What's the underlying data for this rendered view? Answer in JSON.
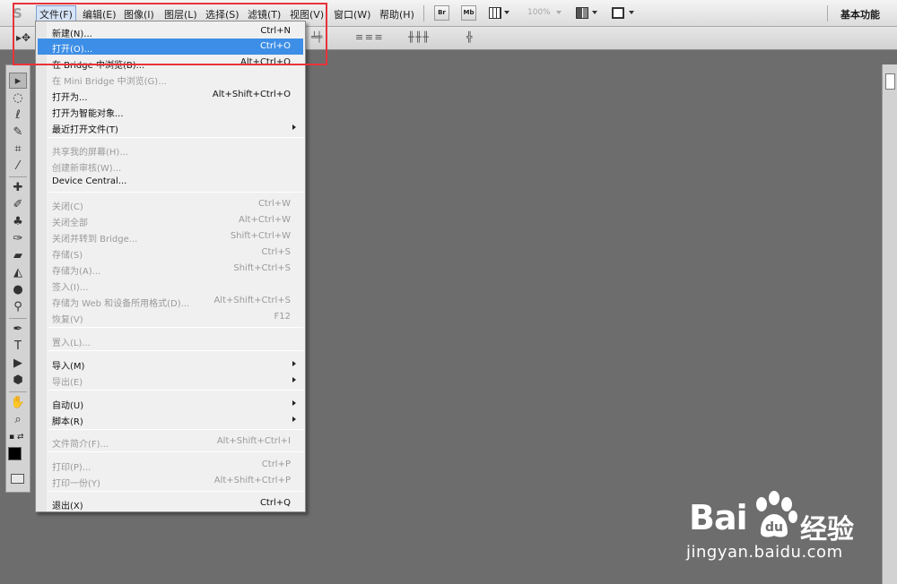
{
  "app": {
    "logo": "S",
    "menus": [
      {
        "label": "文件(F)",
        "open": true
      },
      {
        "label": "编辑(E)"
      },
      {
        "label": "图像(I)"
      },
      {
        "label": "图层(L)"
      },
      {
        "label": "选择(S)"
      },
      {
        "label": "滤镜(T)"
      },
      {
        "label": "视图(V)"
      },
      {
        "label": "窗口(W)"
      },
      {
        "label": "帮助(H)"
      }
    ],
    "bridge_button": "Br",
    "minibridge_button": "Mb",
    "zoom_level": "100%",
    "workspace": "基本功能"
  },
  "file_menu": {
    "items": [
      {
        "label": "新建(N)...",
        "shortcut": "Ctrl+N"
      },
      {
        "label": "打开(O)...",
        "shortcut": "Ctrl+O",
        "highlighted": true
      },
      {
        "label": "在 Bridge 中浏览(B)...",
        "shortcut": "Alt+Ctrl+O"
      },
      {
        "label": "在 Mini Bridge 中浏览(G)...",
        "shortcut": "",
        "disabled": true
      },
      {
        "label": "打开为...",
        "shortcut": "Alt+Shift+Ctrl+O"
      },
      {
        "label": "打开为智能对象...",
        "shortcut": ""
      },
      {
        "label": "最近打开文件(T)",
        "shortcut": "",
        "submenu": true
      },
      {
        "label": "共享我的屏幕(H)...",
        "shortcut": "",
        "disabled": true
      },
      {
        "label": "创建新审核(W)...",
        "shortcut": "",
        "disabled": true
      },
      {
        "label": "Device Central...",
        "shortcut": ""
      },
      {
        "label": "关闭(C)",
        "shortcut": "Ctrl+W",
        "disabled": true
      },
      {
        "label": "关闭全部",
        "shortcut": "Alt+Ctrl+W",
        "disabled": true
      },
      {
        "label": "关闭并转到 Bridge...",
        "shortcut": "Shift+Ctrl+W",
        "disabled": true
      },
      {
        "label": "存储(S)",
        "shortcut": "Ctrl+S",
        "disabled": true
      },
      {
        "label": "存储为(A)...",
        "shortcut": "Shift+Ctrl+S",
        "disabled": true
      },
      {
        "label": "签入(I)...",
        "shortcut": "",
        "disabled": true
      },
      {
        "label": "存储为 Web 和设备所用格式(D)...",
        "shortcut": "Alt+Shift+Ctrl+S",
        "disabled": true
      },
      {
        "label": "恢复(V)",
        "shortcut": "F12",
        "disabled": true
      },
      {
        "label": "置入(L)...",
        "shortcut": "",
        "disabled": true
      },
      {
        "label": "导入(M)",
        "shortcut": "",
        "submenu": true
      },
      {
        "label": "导出(E)",
        "shortcut": "",
        "submenu": true,
        "disabled": true
      },
      {
        "label": "自动(U)",
        "shortcut": "",
        "submenu": true
      },
      {
        "label": "脚本(R)",
        "shortcut": "",
        "submenu": true
      },
      {
        "label": "文件简介(F)...",
        "shortcut": "Alt+Shift+Ctrl+I",
        "disabled": true
      },
      {
        "label": "打印(P)...",
        "shortcut": "Ctrl+P",
        "disabled": true
      },
      {
        "label": "打印一份(Y)",
        "shortcut": "Alt+Shift+Ctrl+P",
        "disabled": true
      },
      {
        "label": "退出(X)",
        "shortcut": "Ctrl+Q"
      }
    ]
  },
  "watermark": {
    "brand_left": "Bai",
    "brand_right": "经验",
    "url": "jingyan.baidu.com"
  },
  "colors": {
    "highlight": "#3d8ee6",
    "annotation": "#e8333a",
    "canvas": "#6d6d6d"
  }
}
